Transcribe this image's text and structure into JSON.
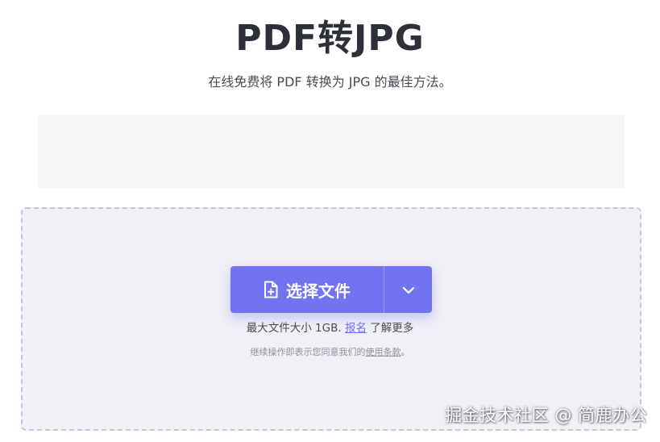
{
  "header": {
    "title": "PDF转JPG",
    "subtitle": "在线免费将 PDF 转换为 JPG 的最佳方法。"
  },
  "upload": {
    "choose_file_label": "选择文件",
    "choose_file_icon": "file-add-icon",
    "dropdown_icon": "chevron-down-icon",
    "size_prefix": "最大文件大小 1GB.",
    "signup_link": "报名",
    "size_suffix": "了解更多",
    "terms_prefix": "继续操作即表示您同意我们的",
    "terms_link": "使用条款",
    "terms_suffix": "。"
  },
  "watermark": {
    "text": "掘金技术社区 @ 简鹿办公"
  },
  "colors": {
    "accent": "#7173f0",
    "dropzone_bg": "#f0f0f6",
    "dropzone_border": "#c6c5dc",
    "title": "#2d3038"
  }
}
